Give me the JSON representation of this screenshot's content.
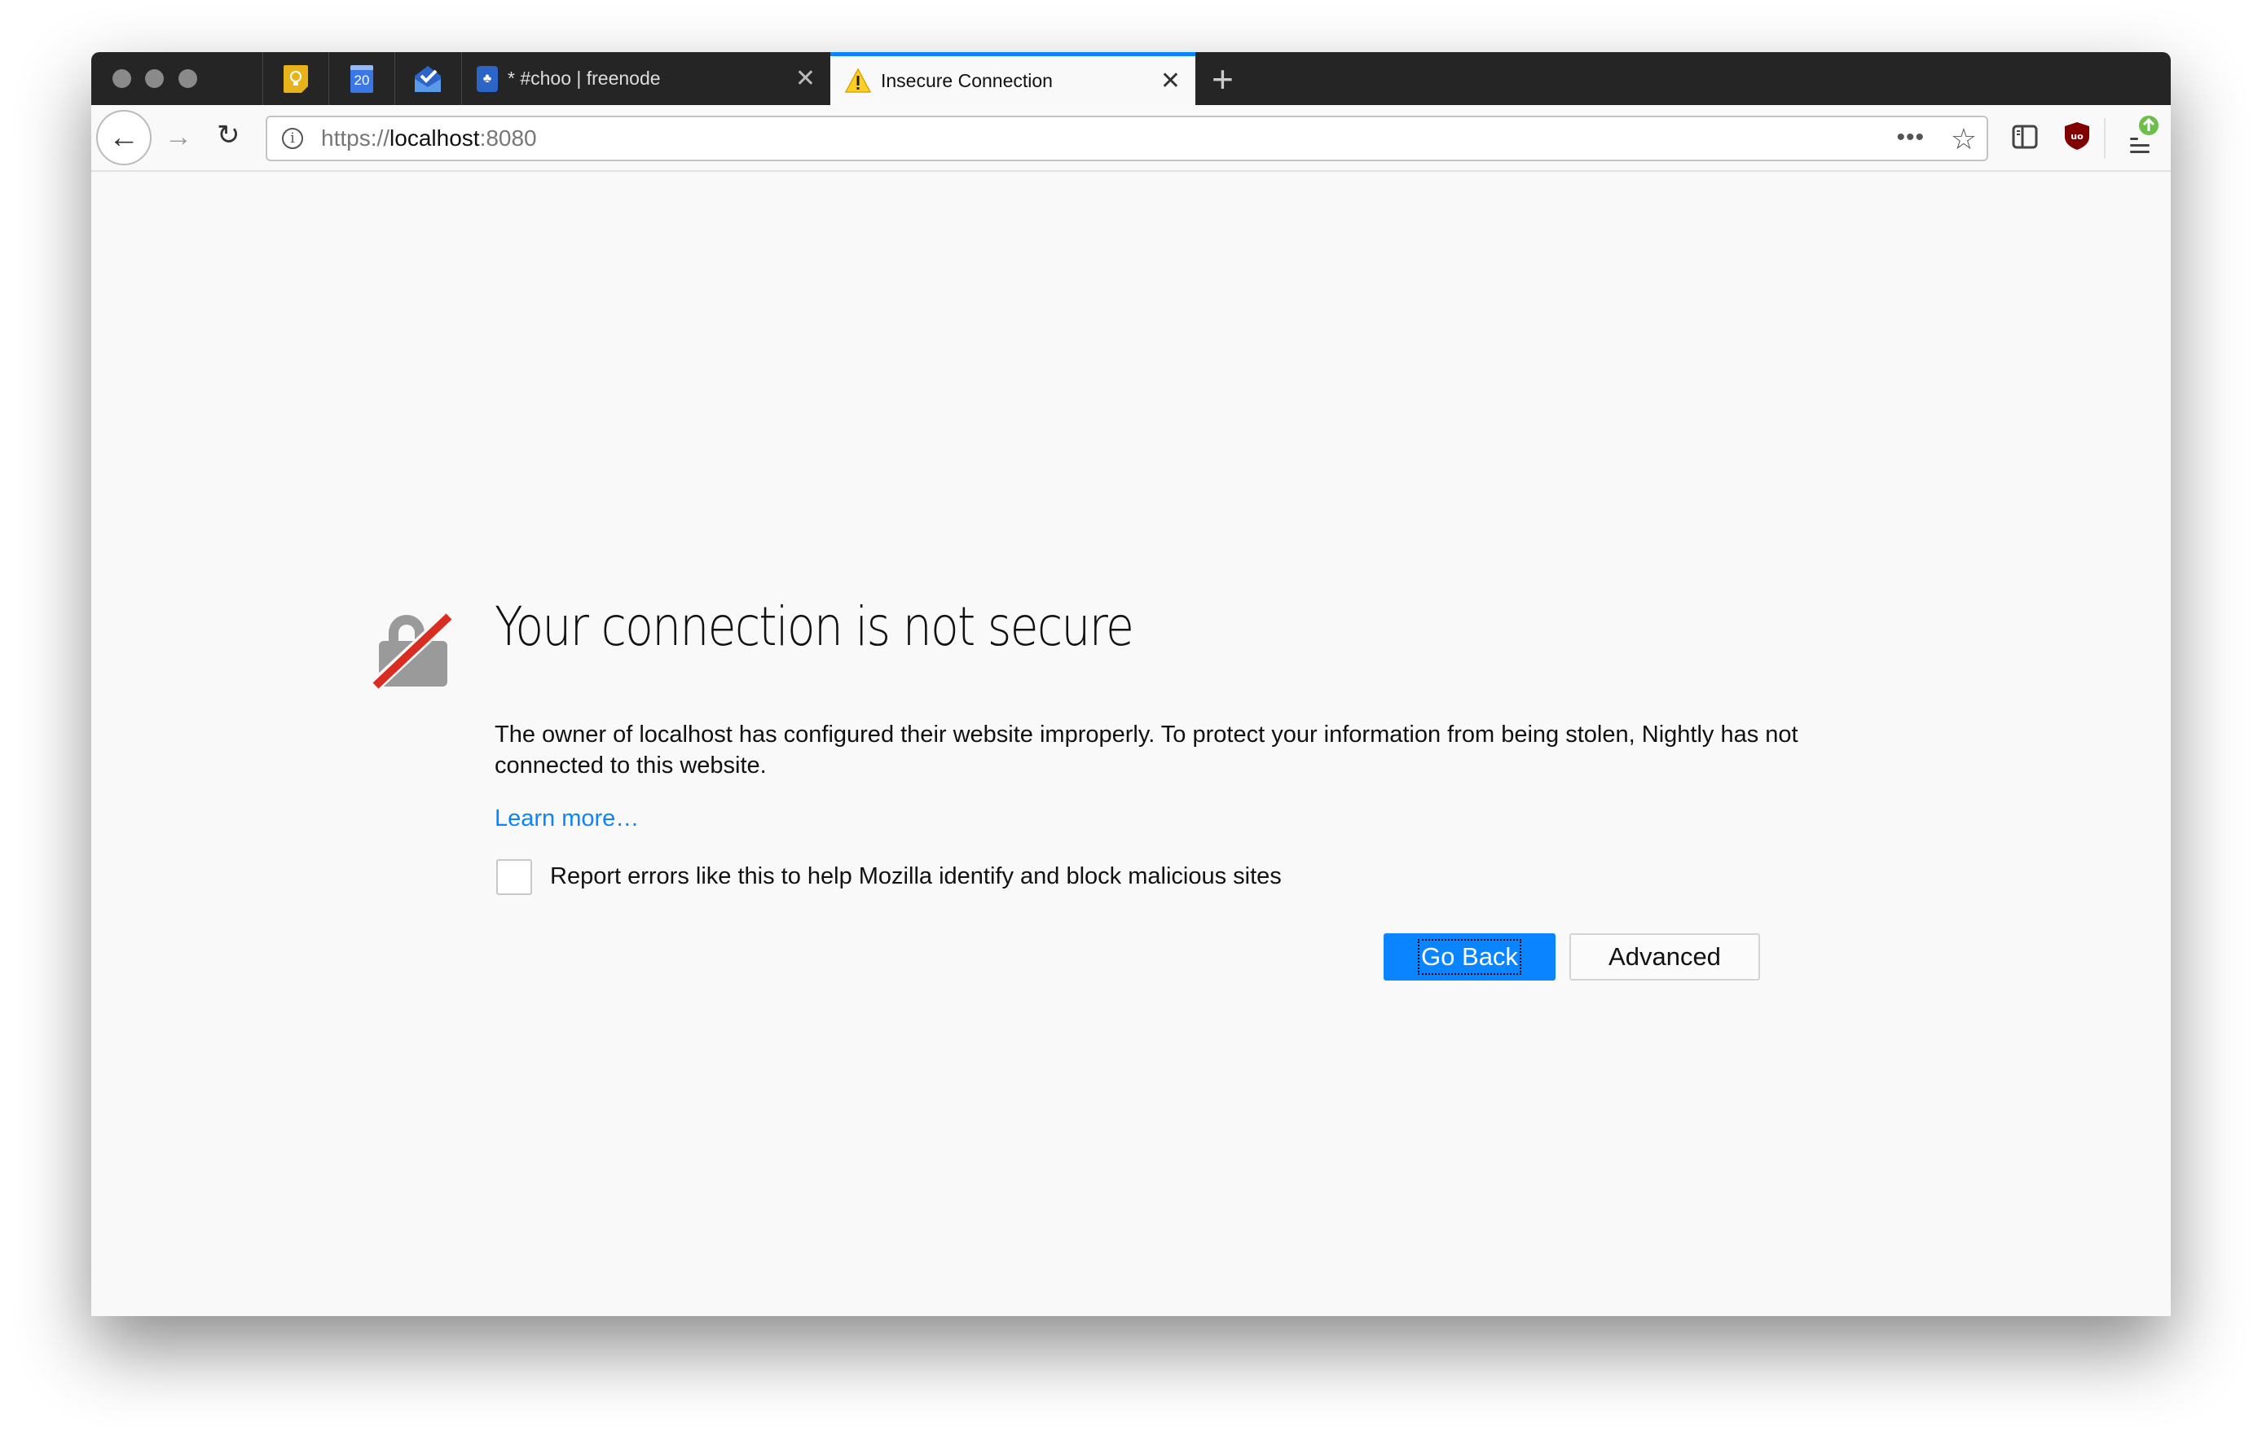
{
  "browser": {
    "tabs": [
      {
        "type": "pinned",
        "icon": "google-keep-icon"
      },
      {
        "type": "pinned",
        "icon": "google-calendar-icon",
        "label": "20"
      },
      {
        "type": "pinned",
        "icon": "inbox-icon"
      },
      {
        "type": "tab",
        "icon": "tree-icon",
        "title": "* #choo | freenode"
      },
      {
        "type": "tab",
        "icon": "warning-icon",
        "title": "Insecure Connection",
        "active": true
      }
    ],
    "url": {
      "scheme": "https://",
      "host": "localhost",
      "port": ":8080"
    },
    "accent": "#0a84ff"
  },
  "page": {
    "title": "Your connection is not secure",
    "description": "The owner of localhost has configured their website improperly. To protect your information from being stolen, Nightly has not connected to this website.",
    "learn_more": "Learn more…",
    "report_label": "Report errors like this to help Mozilla identify and block malicious sites",
    "report_checked": false,
    "go_back": "Go Back",
    "advanced": "Advanced"
  }
}
